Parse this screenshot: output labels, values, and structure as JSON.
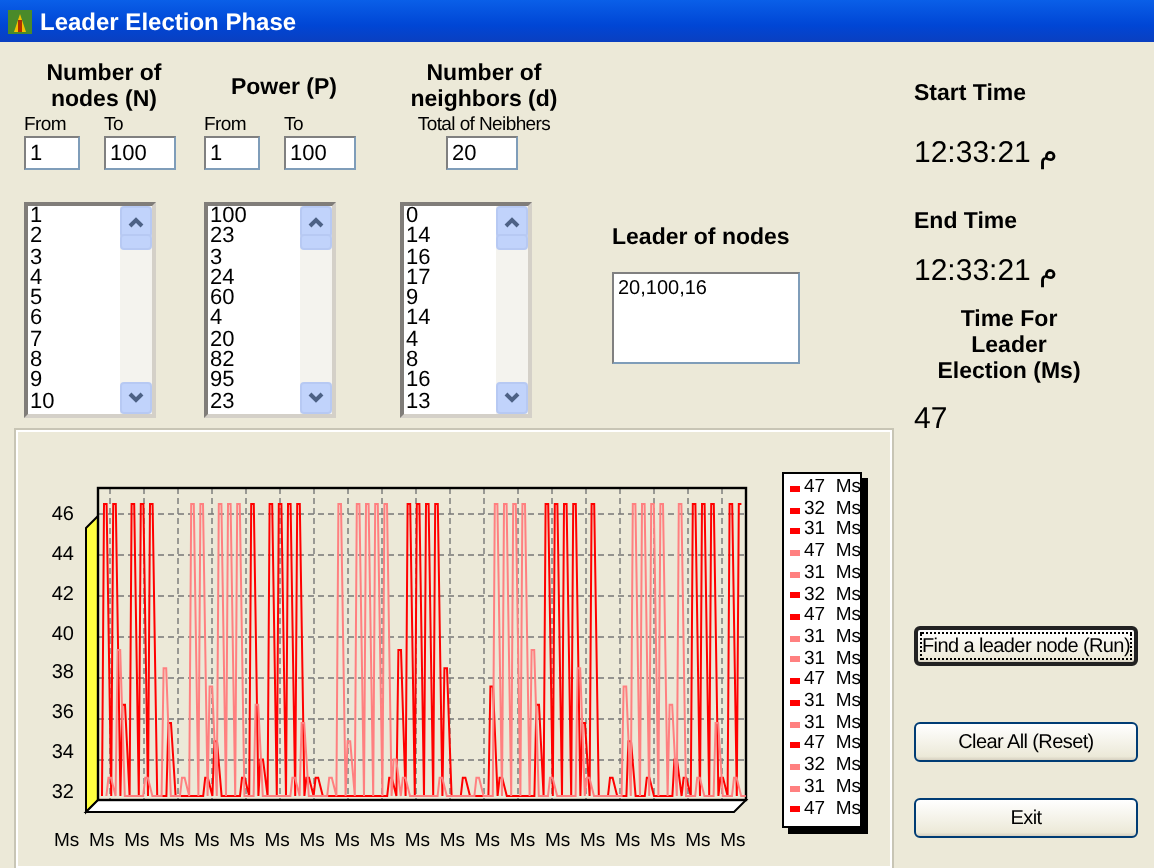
{
  "window": {
    "title": "Leader Election Phase"
  },
  "nodes": {
    "heading": "Number of nodes (N)",
    "from_label": "From",
    "to_label": "To",
    "from_value": "1",
    "to_value": "100",
    "items": [
      "1",
      "2",
      "3",
      "4",
      "5",
      "6",
      "7",
      "8",
      "9",
      "10"
    ]
  },
  "power": {
    "heading": "Power (P)",
    "from_label": "From",
    "to_label": "To",
    "from_value": "1",
    "to_value": "100",
    "items": [
      "100",
      "23",
      "3",
      "24",
      "60",
      "4",
      "20",
      "82",
      "95",
      "23"
    ]
  },
  "neighbors": {
    "heading": "Number of neighbors (d)",
    "total_label": "Total of Neibhers",
    "total_value": "20",
    "items": [
      "0",
      "14",
      "16",
      "17",
      "9",
      "14",
      "4",
      "8",
      "16",
      "13"
    ]
  },
  "leader": {
    "label": "Leader of nodes",
    "value": "20,100,16"
  },
  "start_time": {
    "label": "Start Time",
    "value": "12:33:21 م"
  },
  "end_time": {
    "label": "End Time",
    "value": "12:33:21 م"
  },
  "elapsed": {
    "label": "Time For Leader Election (Ms)",
    "value": "47"
  },
  "chart": {
    "y_labels": [
      "46",
      "44",
      "42",
      "40",
      "38",
      "36",
      "34",
      "32"
    ],
    "x_labels": [
      "Ms",
      "Ms",
      "Ms",
      "Ms",
      "Ms",
      "Ms",
      "Ms",
      "Ms",
      "Ms",
      "Ms",
      "Ms",
      "Ms",
      "Ms",
      "Ms",
      "Ms",
      "Ms",
      "Ms",
      "Ms",
      "Ms",
      "Ms"
    ],
    "legend": [
      {
        "text": "47  Ms",
        "color": "#ff0000"
      },
      {
        "text": "32  Ms",
        "color": "#ff0000"
      },
      {
        "text": "31  Ms",
        "color": "#ff0000"
      },
      {
        "text": "47  Ms",
        "color": "#ff8080"
      },
      {
        "text": "31  Ms",
        "color": "#ff8080"
      },
      {
        "text": "32  Ms",
        "color": "#ff0000"
      },
      {
        "text": "47  Ms",
        "color": "#ff0000"
      },
      {
        "text": "31  Ms",
        "color": "#ff8080"
      },
      {
        "text": "31  Ms",
        "color": "#ff8080"
      },
      {
        "text": "47  Ms",
        "color": "#ff0000"
      },
      {
        "text": "31  Ms",
        "color": "#ff0000"
      },
      {
        "text": "31  Ms",
        "color": "#ff8080"
      },
      {
        "text": "47  Ms",
        "color": "#ff0000"
      },
      {
        "text": "32  Ms",
        "color": "#ff8080"
      },
      {
        "text": "31  Ms",
        "color": "#ff8080"
      },
      {
        "text": "47  Ms",
        "color": "#ff0000"
      }
    ]
  },
  "buttons": [
    {
      "label": "Find a leader node (Run)",
      "focused": true
    },
    {
      "label": "Clear All (Reset)",
      "focused": false
    },
    {
      "label": "Exit",
      "focused": false
    }
  ]
}
